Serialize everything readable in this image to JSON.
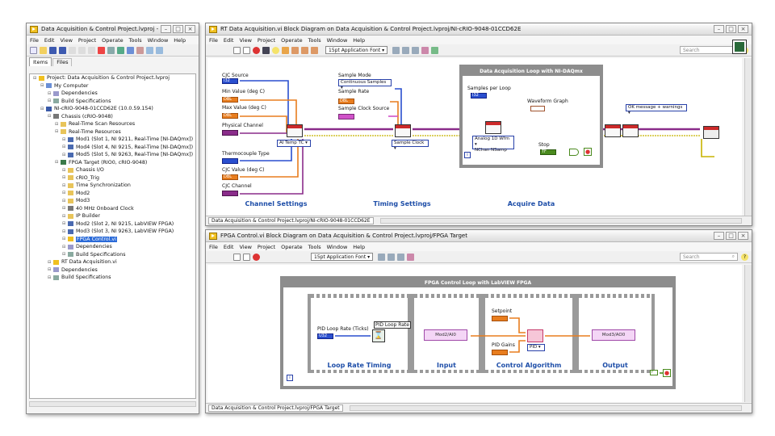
{
  "project_window": {
    "title": "Data Acquisition & Control Project.lvproj - Pr...",
    "menu": [
      "File",
      "Edit",
      "View",
      "Project",
      "Operate",
      "Tools",
      "Window",
      "Help"
    ],
    "tabs": [
      "Items",
      "Files"
    ],
    "tree": [
      {
        "label": "Project: Data Acquisition & Control Project.lvproj",
        "indent": 0,
        "icon": "project-icon"
      },
      {
        "label": "My Computer",
        "indent": 1,
        "icon": "computer-icon"
      },
      {
        "label": "Dependencies",
        "indent": 2,
        "icon": "dependencies-icon"
      },
      {
        "label": "Build Specifications",
        "indent": 2,
        "icon": "build-icon"
      },
      {
        "label": "NI-cRIO-9048-01CCD62E (10.0.59.154)",
        "indent": 1,
        "icon": "target-icon"
      },
      {
        "label": "Chassis (cRIO-9048)",
        "indent": 2,
        "icon": "chassis-icon"
      },
      {
        "label": "Real-Time Scan Resources",
        "indent": 3,
        "icon": "folder-icon"
      },
      {
        "label": "Real-Time Resources",
        "indent": 3,
        "icon": "folder-icon"
      },
      {
        "label": "Mod1 (Slot 1, NI 9211, Real-Time [NI-DAQmx])",
        "indent": 4,
        "icon": "module-icon"
      },
      {
        "label": "Mod4 (Slot 4, NI 9215, Real-Time [NI-DAQmx])",
        "indent": 4,
        "icon": "module-icon"
      },
      {
        "label": "Mod5 (Slot 5, NI 9263, Real-Time [NI-DAQmx])",
        "indent": 4,
        "icon": "module-icon"
      },
      {
        "label": "FPGA Target (RIO0, cRIO-9048)",
        "indent": 3,
        "icon": "fpga-icon"
      },
      {
        "label": "Chassis I/O",
        "indent": 4,
        "icon": "folder-icon"
      },
      {
        "label": "cRIO_Trig",
        "indent": 4,
        "icon": "folder-icon"
      },
      {
        "label": "Time Synchronization",
        "indent": 4,
        "icon": "folder-icon"
      },
      {
        "label": "Mod2",
        "indent": 4,
        "icon": "folder-icon"
      },
      {
        "label": "Mod3",
        "indent": 4,
        "icon": "folder-icon"
      },
      {
        "label": "40 MHz Onboard Clock",
        "indent": 4,
        "icon": "clock-icon"
      },
      {
        "label": "IP Builder",
        "indent": 4,
        "icon": "folder-icon"
      },
      {
        "label": "Mod2 (Slot 2, NI 9215, LabVIEW FPGA)",
        "indent": 4,
        "icon": "module-icon"
      },
      {
        "label": "Mod3 (Slot 3, NI 9263, LabVIEW FPGA)",
        "indent": 4,
        "icon": "module-icon"
      },
      {
        "label": "FPGA Control.vi",
        "indent": 4,
        "icon": "vi-icon",
        "selected": true
      },
      {
        "label": "Dependencies",
        "indent": 4,
        "icon": "dependencies-icon"
      },
      {
        "label": "Build Specifications",
        "indent": 4,
        "icon": "build-icon"
      },
      {
        "label": "RT Data Acquisition.vi",
        "indent": 2,
        "icon": "vi-icon"
      },
      {
        "label": "Dependencies",
        "indent": 2,
        "icon": "dependencies-icon"
      },
      {
        "label": "Build Specifications",
        "indent": 2,
        "icon": "build-icon"
      }
    ]
  },
  "rt_window": {
    "title": "RT Data Acquisition.vi Block Diagram on Data Acquisition & Control Project.lvproj/NI-cRIO-9048-01CCD62E",
    "menu": [
      "File",
      "Edit",
      "View",
      "Project",
      "Operate",
      "Tools",
      "Window",
      "Help"
    ],
    "font": "15pt Application Font",
    "search_placeholder": "Search",
    "status_path": "Data Acquisition & Control Project.lvproj/NI-cRIO-9048-01CCD62E",
    "labels": {
      "cjc_source": "CJC Source",
      "min_value": "Min Value (deg C)",
      "max_value": "Max Value (deg C)",
      "physical_channel": "Physical Channel",
      "thermocouple_type": "Thermocouple Type",
      "cjc_value": "CJC Value (deg C)",
      "cjc_channel": "CJC Channel",
      "ai_temp_tc": "AI Temp TC",
      "sample_mode": "Sample Mode",
      "sample_mode_value": "Continuous Samples",
      "sample_rate": "Sample Rate",
      "sample_clock_source": "Sample Clock Source",
      "sample_clock": "Sample Clock",
      "loop_title": "Data Acquisition Loop with NI-DAQmx",
      "samples_per_loop": "Samples per Loop",
      "waveform_graph": "Waveform Graph",
      "analog_1d": "Analog 1D Wfm",
      "nchan_nsamp": "NChan NSamp",
      "stop": "Stop",
      "ok_message": "OK message + warnings",
      "i32": "I32",
      "dbl": "DBL",
      "tf": "TF"
    },
    "sections": [
      "Channel Settings",
      "Timing Settings",
      "Acquire Data"
    ]
  },
  "fpga_window": {
    "title": "FPGA Control.vi Block Diagram on Data Acquisition & Control Project.lvproj/FPGA Target",
    "menu": [
      "File",
      "Edit",
      "View",
      "Project",
      "Operate",
      "Tools",
      "Window",
      "Help"
    ],
    "font": "15pt Application Font",
    "search_placeholder": "Search",
    "status_path": "Data Acquisition & Control Project.lvproj/FPGA Target",
    "labels": {
      "loop_title": "FPGA Control Loop with LabVIEW FPGA",
      "pid_loop_rate_ticks": "PID Loop Rate (Ticks)",
      "pid_loop_rate": "PID Loop Rate",
      "u32": "U32",
      "mod2_ai0": "Mod2/AI0",
      "setpoint": "Setpoint",
      "pid_gains": "PID Gains",
      "pid": "PID",
      "mod3_ao0": "Mod3/AO0"
    },
    "sections": [
      "Loop Rate Timing",
      "Input",
      "Control Algorithm",
      "Output"
    ]
  },
  "colors": {
    "wire_orange": "#e87d1e",
    "wire_blue": "#2a4fcf",
    "wire_purple": "#8a2c8a",
    "wire_green": "#4a8a1e",
    "wire_pink": "#d052c8",
    "wire_yellow": "#c8b400",
    "section_blue": "#1e4ea8"
  }
}
